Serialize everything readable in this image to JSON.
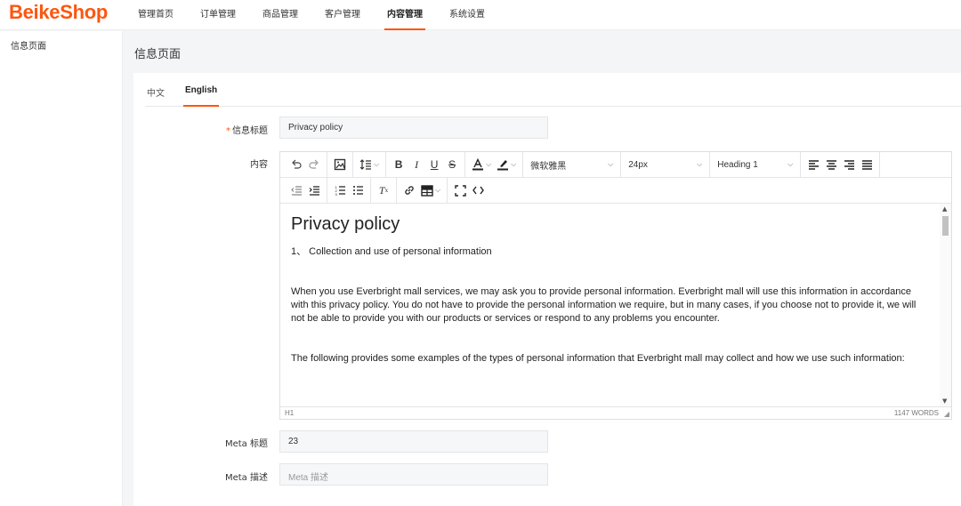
{
  "app": {
    "logo": "BeikeShop",
    "brand_color": "#fd560f"
  },
  "nav": {
    "items": [
      {
        "label": "管理首页",
        "active": false
      },
      {
        "label": "订单管理",
        "active": false
      },
      {
        "label": "商品管理",
        "active": false
      },
      {
        "label": "客户管理",
        "active": false
      },
      {
        "label": "内容管理",
        "active": true
      },
      {
        "label": "系统设置",
        "active": false
      }
    ]
  },
  "sidebar": {
    "items": [
      {
        "label": "信息页面"
      }
    ]
  },
  "page": {
    "title": "信息页面"
  },
  "tabs": [
    {
      "label": "中文",
      "active": false
    },
    {
      "label": "English",
      "active": true
    }
  ],
  "form": {
    "title_label": "信息标题",
    "title_required_mark": "*",
    "title_value": "Privacy policy",
    "content_label": "内容",
    "meta_title_label": "Meta 标题",
    "meta_title_value": "23",
    "meta_desc_label": "Meta 描述",
    "meta_desc_placeholder": "Meta 描述"
  },
  "editor": {
    "font_family": "微软雅黑",
    "font_size": "24px",
    "block_format": "Heading 1",
    "heading": "Privacy policy",
    "paragraphs": [
      "1、 Collection and use of personal information",
      "When you use Everbright mall services, we may ask you to provide personal information. Everbright mall will use this information in accordance with this privacy policy. You do not have to provide the personal information we require, but in many cases, if you choose not to provide it, we will not be able to provide you with our products or services or respond to any problems you encounter.",
      "The following provides some examples of the types of personal information that Everbright mall may collect and how we use such information:"
    ],
    "status_path": "H1",
    "word_count": "1147 WORDS"
  },
  "icons": {
    "undo": "undo-icon",
    "redo": "redo-icon",
    "image": "image-icon",
    "line_height": "line-height-icon",
    "bold": "bold-icon",
    "italic": "italic-icon",
    "underline": "underline-icon",
    "strike": "strikethrough-icon",
    "text_color": "text-color-icon",
    "highlight": "highlight-icon",
    "align_left": "align-left-icon",
    "align_center": "align-center-icon",
    "align_right": "align-right-icon",
    "justify": "justify-icon",
    "outdent": "outdent-icon",
    "indent": "indent-icon",
    "numbered_list": "numbered-list-icon",
    "bullet_list": "bullet-list-icon",
    "clear_format": "clear-format-icon",
    "link": "link-icon",
    "table": "table-icon",
    "fullscreen": "fullscreen-icon",
    "code": "code-icon"
  }
}
